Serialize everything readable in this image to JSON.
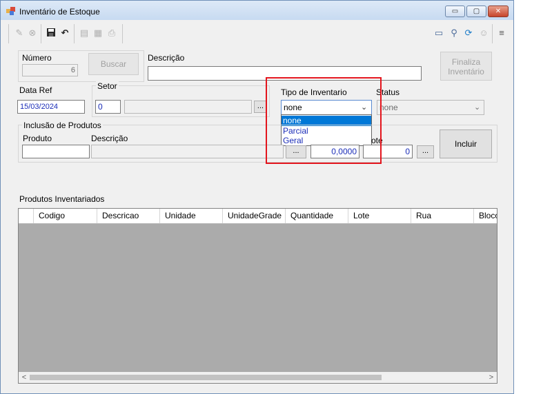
{
  "window": {
    "title": "Inventário de Estoque",
    "controls": {
      "minimize": "▭",
      "maximize": "▢",
      "close": "✕"
    }
  },
  "toolbar": {
    "icons": [
      "edit-icon",
      "cancel-icon",
      "save-icon",
      "undo-icon",
      "list-icon",
      "report-icon",
      "print-icon",
      "card-icon",
      "search-users-icon",
      "refresh-icon",
      "user-icon",
      "menu-icon"
    ]
  },
  "form": {
    "numero_label": "Número",
    "numero_value": "6",
    "buscar_label": "Buscar",
    "descricao_label": "Descrição",
    "descricao_value": "",
    "finaliza_label_1": "Finaliza",
    "finaliza_label_2": "Inventário",
    "data_ref_label": "Data Ref",
    "data_ref_value": "15/03/2024",
    "setor_label": "Setor",
    "setor_code": "0",
    "setor_name": "",
    "ellipsis": "...",
    "tipo_label": "Tipo de Inventario",
    "tipo_value": "none",
    "tipo_options": [
      "none",
      "Parcial",
      "Geral"
    ],
    "status_label": "Status",
    "status_value": "none"
  },
  "inclusao": {
    "group_label": "Inclusão de Produtos",
    "produto_label": "Produto",
    "produto_value": "",
    "descricao_label": "Descrição",
    "descricao_value": "",
    "quantidade_value": "0,0000",
    "lote_label": "ote",
    "lote_value": "0",
    "incluir_label": "Incluir"
  },
  "grid": {
    "label": "Produtos Inventariados",
    "columns": [
      "Codigo",
      "Descricao",
      "Unidade",
      "UnidadeGrade",
      "Quantidade",
      "Lote",
      "Rua",
      "Bloco"
    ],
    "scroll_left": "<",
    "scroll_right": ">"
  },
  "colors": {
    "highlight": "#e3141c",
    "selection": "#0078d7",
    "link_text": "#1a2cb8"
  }
}
